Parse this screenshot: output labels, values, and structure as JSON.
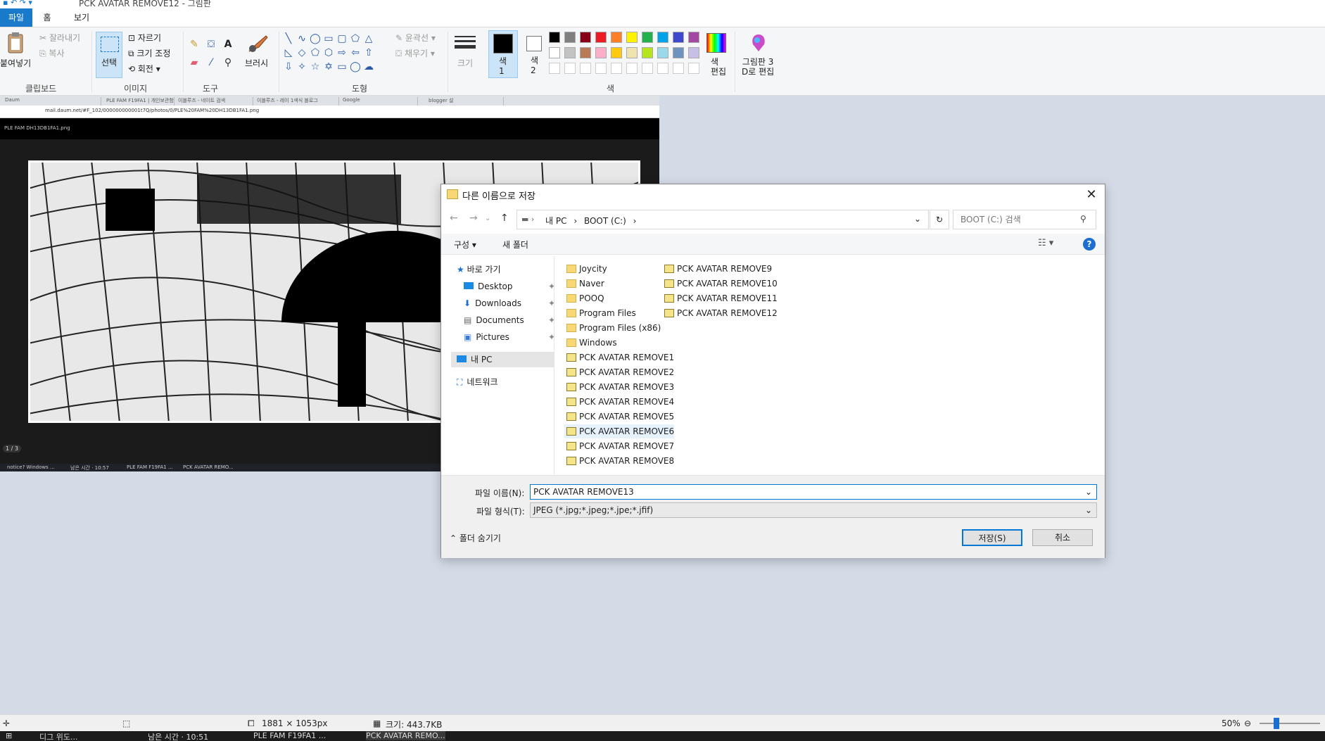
{
  "window": {
    "title": "PCK AVATAR REMOVE12 - 그림판"
  },
  "menu": {
    "file": "파일",
    "home": "홈",
    "view": "보기"
  },
  "ribbon": {
    "clipboard": {
      "paste": "붙여넣기",
      "cut": "잘라내기",
      "copy": "복사",
      "group": "클립보드"
    },
    "image": {
      "select": "선택",
      "crop": "자르기",
      "resize": "크기 조정",
      "rotate": "회전",
      "group": "이미지"
    },
    "tools": {
      "group": "도구"
    },
    "brushes": {
      "label": "브러시"
    },
    "shapes": {
      "outline": "윤곽선",
      "fill": "채우기",
      "group": "도형"
    },
    "size": {
      "label": "크기"
    },
    "color1": {
      "label": "색\n1"
    },
    "color2": {
      "label": "색\n2"
    },
    "colors_group": "색",
    "edit_colors": "색\n편집",
    "paint3d": "그림판 3\nD로 편집",
    "palette_row1": [
      "#000000",
      "#7f7f7f",
      "#880015",
      "#ed1c24",
      "#ff7f27",
      "#fff200",
      "#22b14c",
      "#00a2e8",
      "#3f48cc",
      "#a349a4"
    ],
    "palette_row2": [
      "#ffffff",
      "#c3c3c3",
      "#b97a57",
      "#ffaec9",
      "#ffc90e",
      "#efe4b0",
      "#b5e61d",
      "#99d9ea",
      "#7092be",
      "#c8bfe7"
    ]
  },
  "canvas": {
    "browser_tabs": [
      "Daum",
      "PLE FAM F19FA1 | 개인보관함",
      "이블루즈 - 네이트 검색",
      "이블루즈 - 레이 1색식 블로그",
      "Google",
      "blogger 설"
    ],
    "url": "mail.daum.net/#F_102/000000000001t7Q/photos/0/PLE%20FAM%20DH13DB1FA1.png",
    "image_name": "PLE FAM DH13DB1FA1.png",
    "page_count": "1 / 3",
    "mini_taskbar": [
      "notice? Windows ...",
      "남은 시간 · 10:57",
      "PLE FAM F19FA1 ...",
      "PCK AVATAR REMO..."
    ]
  },
  "dialog": {
    "title": "다른 이름으로 저장",
    "breadcrumb": [
      "내 PC",
      "BOOT (C:)"
    ],
    "search_placeholder": "BOOT (C:) 검색",
    "organize": "구성",
    "new_folder": "새 폴더",
    "nav": {
      "quick_access": "바로 가기",
      "items": [
        "Desktop",
        "Downloads",
        "Documents",
        "Pictures"
      ],
      "this_pc": "내 PC",
      "network": "네트워크"
    },
    "files_col1": [
      {
        "name": "Joycity",
        "type": "folder"
      },
      {
        "name": "Naver",
        "type": "folder"
      },
      {
        "name": "POOQ",
        "type": "folder"
      },
      {
        "name": "Program Files",
        "type": "folder"
      },
      {
        "name": "Program Files (x86)",
        "type": "folder"
      },
      {
        "name": "Windows",
        "type": "folder"
      },
      {
        "name": "PCK AVATAR REMOVE1",
        "type": "image"
      },
      {
        "name": "PCK AVATAR REMOVE2",
        "type": "image"
      },
      {
        "name": "PCK AVATAR REMOVE3",
        "type": "image"
      },
      {
        "name": "PCK AVATAR REMOVE4",
        "type": "image"
      },
      {
        "name": "PCK AVATAR REMOVE5",
        "type": "image"
      },
      {
        "name": "PCK AVATAR REMOVE6",
        "type": "image"
      },
      {
        "name": "PCK AVATAR REMOVE7",
        "type": "image"
      },
      {
        "name": "PCK AVATAR REMOVE8",
        "type": "image"
      }
    ],
    "files_col2": [
      {
        "name": "PCK AVATAR REMOVE9",
        "type": "image"
      },
      {
        "name": "PCK AVATAR REMOVE10",
        "type": "image"
      },
      {
        "name": "PCK AVATAR REMOVE11",
        "type": "image"
      },
      {
        "name": "PCK AVATAR REMOVE12",
        "type": "image"
      }
    ],
    "selected_file": "PCK AVATAR REMOVE6",
    "filename_label": "파일 이름(N):",
    "filename_value": "PCK AVATAR REMOVE13",
    "filetype_label": "파일 형식(T):",
    "filetype_value": "JPEG (*.jpg;*.jpeg;*.jpe;*.jfif)",
    "hide_folders": "폴더 숨기기",
    "save": "저장(S)",
    "cancel": "취소"
  },
  "status": {
    "dimensions": "1881 × 1053px",
    "size": "크기: 443.7KB",
    "zoom": "50%"
  },
  "taskbar": [
    "디그 위도...",
    "남은 시간 · 10:51",
    "PLE FAM F19FA1 ...",
    "PCK AVATAR REMO..."
  ]
}
